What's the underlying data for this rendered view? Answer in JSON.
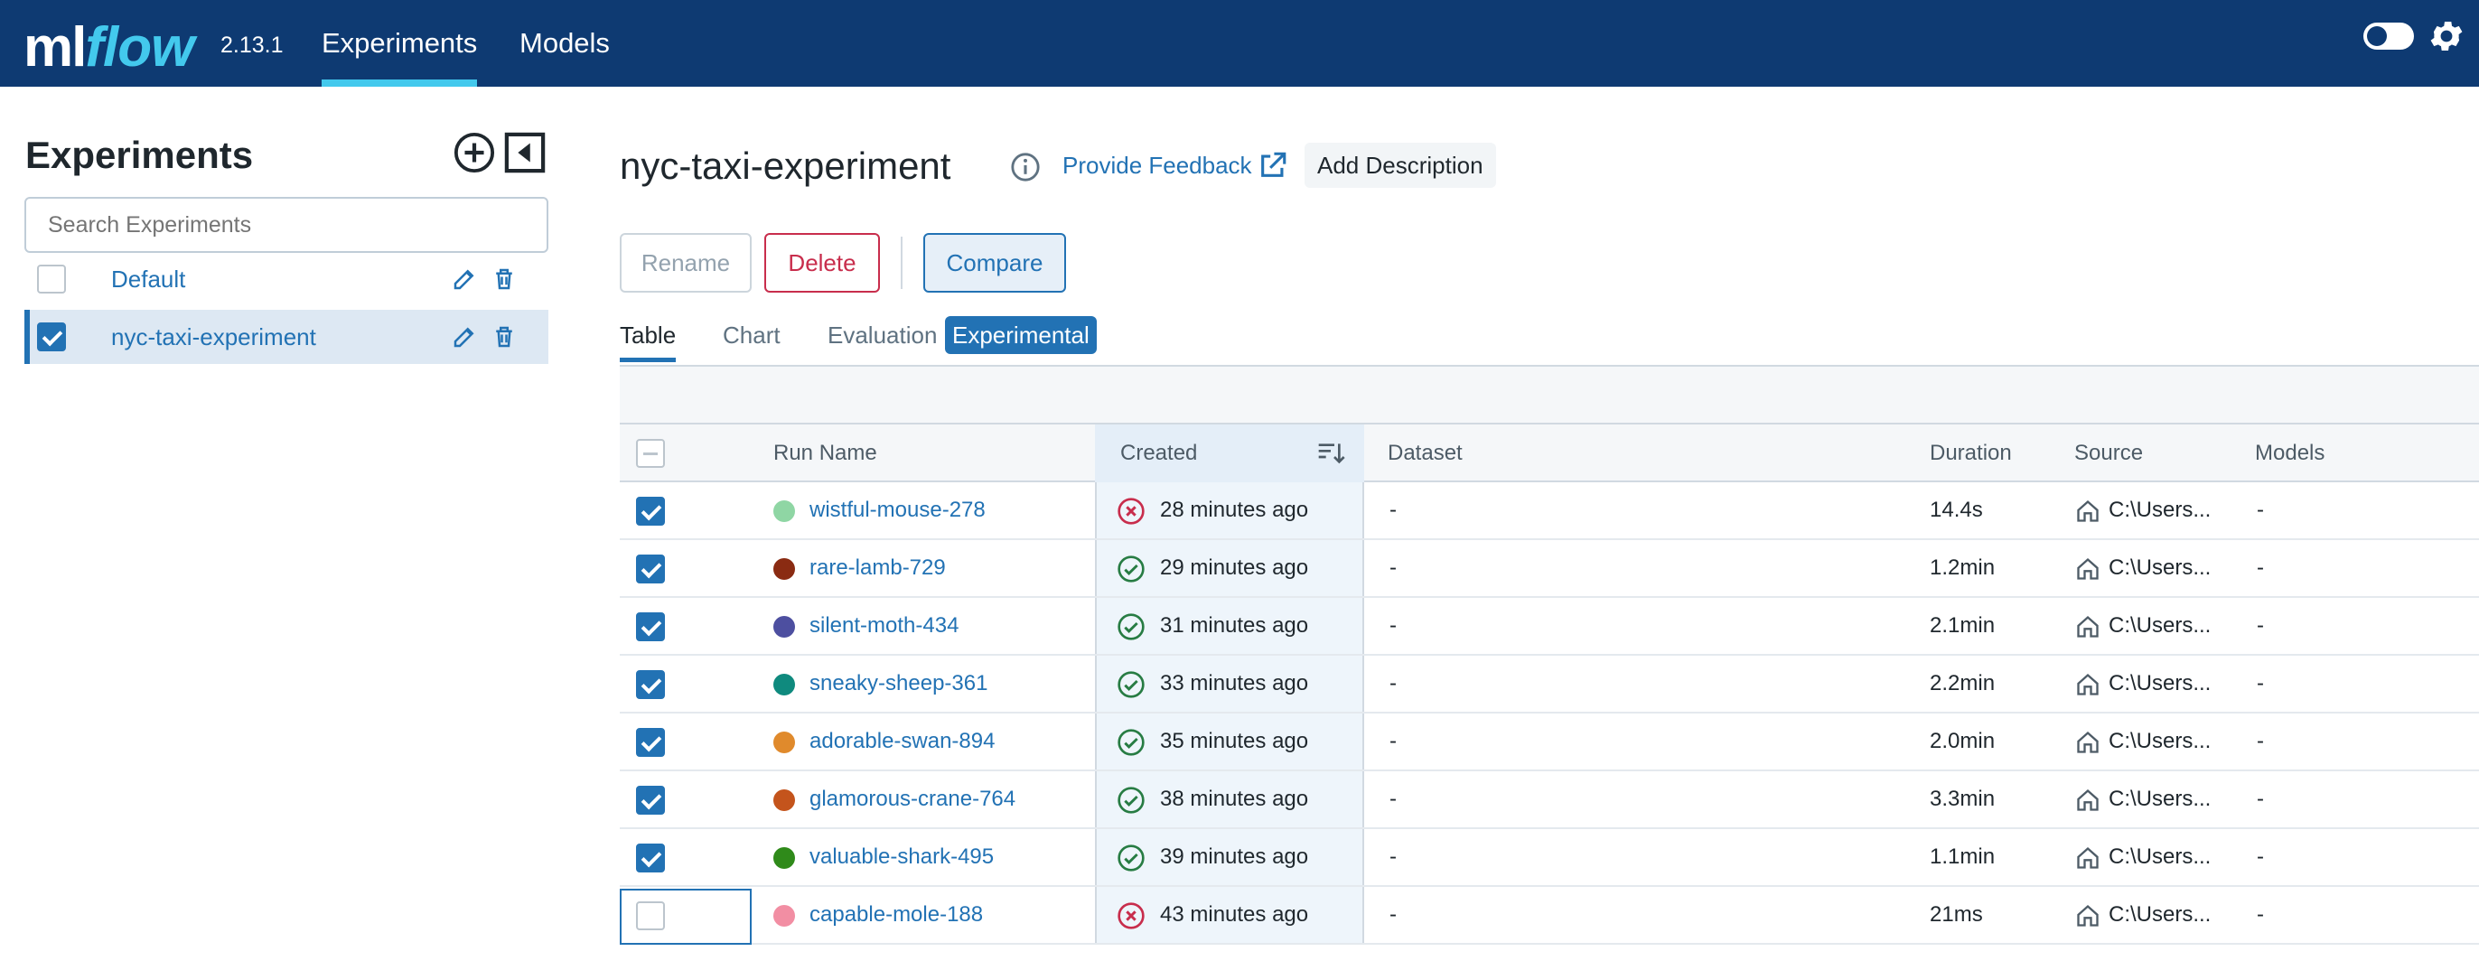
{
  "header": {
    "logo_ml": "ml",
    "logo_flow": "flow",
    "version": "2.13.1",
    "tabs": [
      {
        "label": "Experiments",
        "active": true
      },
      {
        "label": "Models",
        "active": false
      }
    ],
    "colors": {
      "bar": "#0e3a72",
      "accent": "#43c9ed"
    }
  },
  "sidebar": {
    "title": "Experiments",
    "search_placeholder": "Search Experiments",
    "experiments": [
      {
        "name": "Default",
        "checked": false
      },
      {
        "name": "nyc-taxi-experiment",
        "checked": true
      }
    ]
  },
  "main": {
    "title": "nyc-taxi-experiment",
    "feedback_label": "Provide Feedback",
    "add_description_label": "Add Description",
    "buttons": {
      "rename": "Rename",
      "delete": "Delete",
      "compare": "Compare"
    },
    "view_tabs": [
      {
        "label": "Table",
        "active": true
      },
      {
        "label": "Chart",
        "active": false
      },
      {
        "label": "Evaluation",
        "active": false
      }
    ],
    "experimental_badge": "Experimental",
    "table": {
      "columns": {
        "run_name": "Run Name",
        "created": "Created",
        "dataset": "Dataset",
        "duration": "Duration",
        "source": "Source",
        "models": "Models"
      },
      "rows": [
        {
          "checked": true,
          "color": "#8fd6a4",
          "name": "wistful-mouse-278",
          "status": "failed",
          "created": "28 minutes ago",
          "dataset": "-",
          "duration": "14.4s",
          "source": "C:\\Users...",
          "models": "-"
        },
        {
          "checked": true,
          "color": "#8a2b12",
          "name": "rare-lamb-729",
          "status": "finished",
          "created": "29 minutes ago",
          "dataset": "-",
          "duration": "1.2min",
          "source": "C:\\Users...",
          "models": "-"
        },
        {
          "checked": true,
          "color": "#4d4fa0",
          "name": "silent-moth-434",
          "status": "finished",
          "created": "31 minutes ago",
          "dataset": "-",
          "duration": "2.1min",
          "source": "C:\\Users...",
          "models": "-"
        },
        {
          "checked": true,
          "color": "#0f8a7e",
          "name": "sneaky-sheep-361",
          "status": "finished",
          "created": "33 minutes ago",
          "dataset": "-",
          "duration": "2.2min",
          "source": "C:\\Users...",
          "models": "-"
        },
        {
          "checked": true,
          "color": "#e08a2c",
          "name": "adorable-swan-894",
          "status": "finished",
          "created": "35 minutes ago",
          "dataset": "-",
          "duration": "2.0min",
          "source": "C:\\Users...",
          "models": "-"
        },
        {
          "checked": true,
          "color": "#c4541c",
          "name": "glamorous-crane-764",
          "status": "finished",
          "created": "38 minutes ago",
          "dataset": "-",
          "duration": "3.3min",
          "source": "C:\\Users...",
          "models": "-"
        },
        {
          "checked": true,
          "color": "#2f8a1a",
          "name": "valuable-shark-495",
          "status": "finished",
          "created": "39 minutes ago",
          "dataset": "-",
          "duration": "1.1min",
          "source": "C:\\Users...",
          "models": "-"
        },
        {
          "checked": false,
          "color": "#f28ea3",
          "name": "capable-mole-188",
          "status": "failed",
          "created": "43 minutes ago",
          "dataset": "-",
          "duration": "21ms",
          "source": "C:\\Users...",
          "models": "-"
        }
      ]
    }
  }
}
